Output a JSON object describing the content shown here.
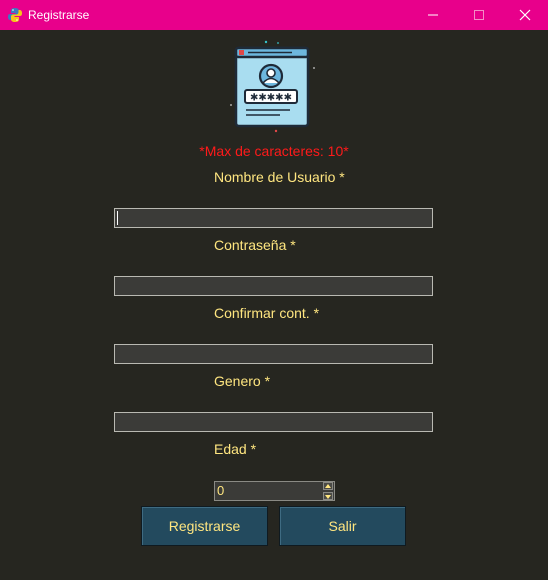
{
  "window": {
    "title": "Registrarse",
    "titlebar_color": "#e8008b",
    "app_icon": "python-icon",
    "controls": [
      "minimize",
      "maximize",
      "close"
    ]
  },
  "header": {
    "icon": "user-profile-password-icon",
    "note": "*Max de caracteres: 10*"
  },
  "form": {
    "username_label": "Nombre de Usuario *",
    "username_value": "",
    "password_label": "Contraseña *",
    "password_value": "",
    "confirm_label": "Confirmar cont. *",
    "confirm_value": "",
    "gender_label": "Genero *",
    "gender_value": "",
    "age_label": "Edad *",
    "age_value": "0"
  },
  "buttons": {
    "register": "Registrarse",
    "exit": "Salir"
  },
  "colors": {
    "background": "#262620",
    "label": "#ffe680",
    "note": "#ff1a1a",
    "button": "#234a5e"
  }
}
